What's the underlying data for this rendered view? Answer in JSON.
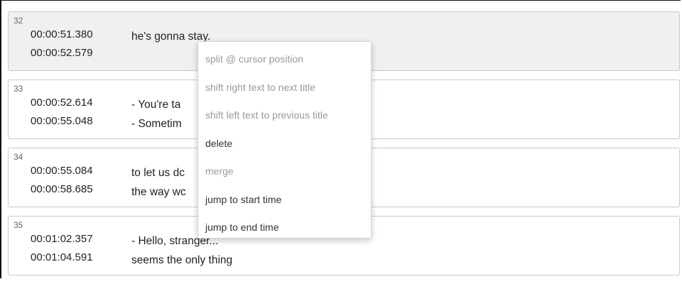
{
  "cues": [
    {
      "index": "32",
      "start": "00:00:51.380",
      "end": "00:00:52.579",
      "line1": "he's gonna stay.",
      "line2": ""
    },
    {
      "index": "33",
      "start": "00:00:52.614",
      "end": "00:00:55.048",
      "line1": "- You're ta",
      "line2": "- Sometim"
    },
    {
      "index": "34",
      "start": "00:00:55.084",
      "end": "00:00:58.685",
      "line1": "to let us dc",
      "line2": "the way wc"
    },
    {
      "index": "35",
      "start": "00:01:02.357",
      "end": "00:01:04.591",
      "line1": "- Hello, stranger...",
      "line2": "seems the only thing"
    }
  ],
  "context_menu": {
    "items": [
      {
        "label": "split @ cursor position",
        "enabled": false
      },
      {
        "label": "shift right text to next title",
        "enabled": false
      },
      {
        "label": "shift left text to previous title",
        "enabled": false
      },
      {
        "label": "delete",
        "enabled": true
      },
      {
        "label": "merge",
        "enabled": false
      },
      {
        "label": "jump to start time",
        "enabled": true
      },
      {
        "label": "jump to end time",
        "enabled": true
      }
    ]
  }
}
